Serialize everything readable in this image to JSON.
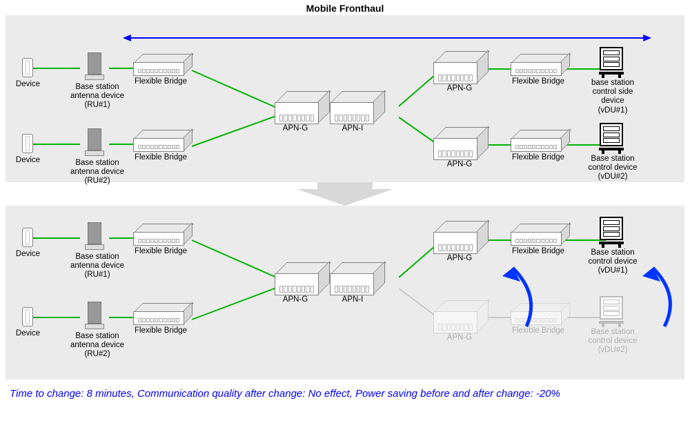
{
  "title": "Mobile Fronthaul",
  "labels": {
    "device": "Device",
    "ru1": "Base station\nantenna device\n(RU#1)",
    "ru2": "Base station\nantenna device\n(RU#2)",
    "fbridge": "Flexible Bridge",
    "apn_g": "APN-G",
    "apn_i": "APN-I",
    "vdu1_top": "base station\ncontrol side\ndevice\n(vDU#1)",
    "vdu1_bot": "Base station\ncontrol device\n(vDU#1)",
    "vdu2": "Base station\ncontrol device\n(vDU#2)"
  },
  "caption": "Time to change: 8 minutes, Communication quality after change: No effect, Power saving before and after change: -20%"
}
